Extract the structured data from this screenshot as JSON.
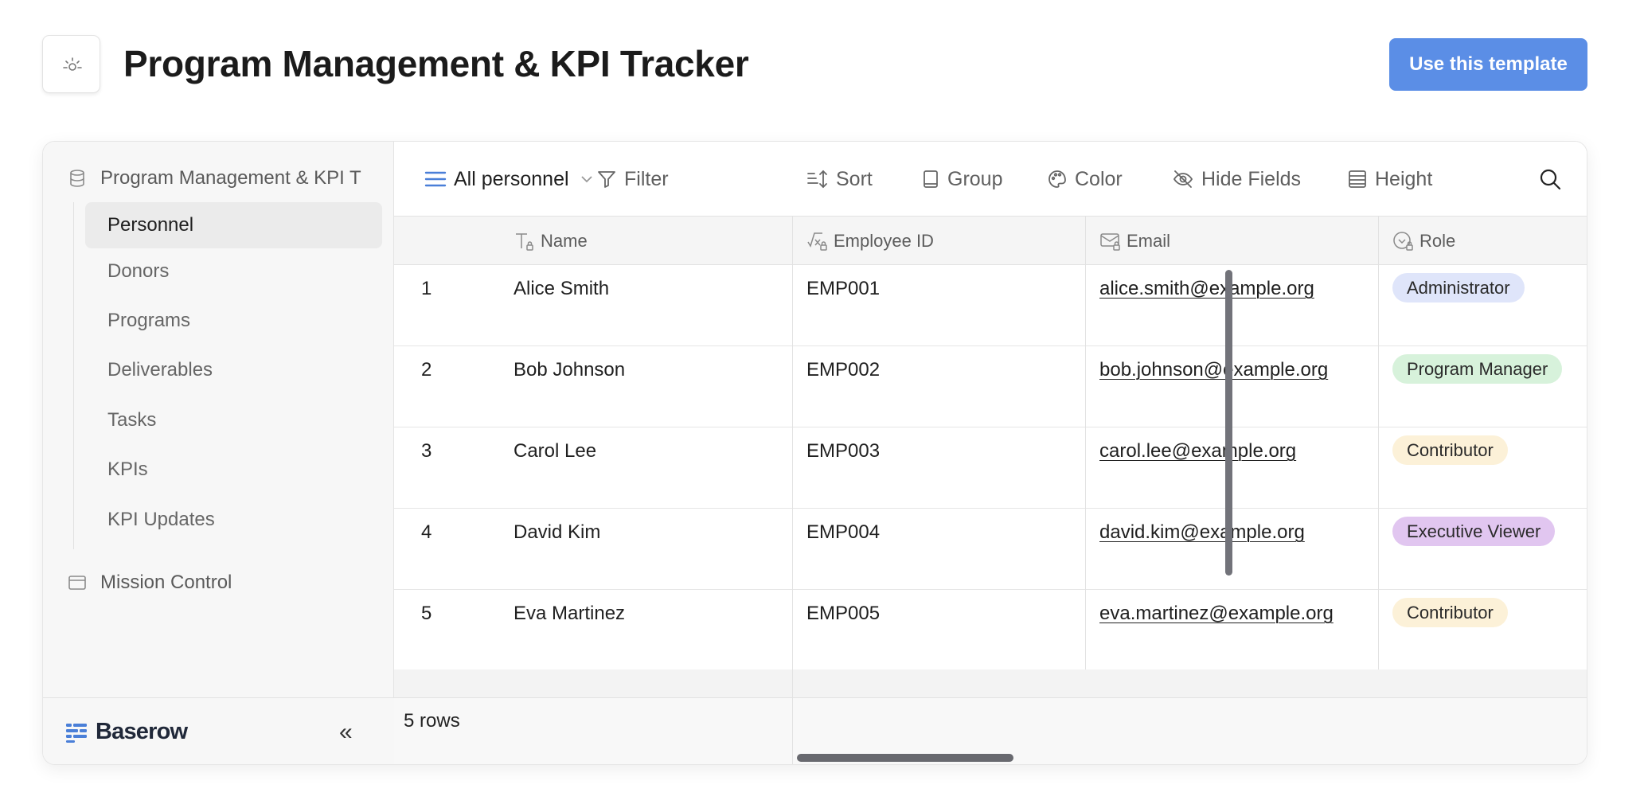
{
  "header": {
    "title": "Program Management & KPI Tracker",
    "cta_label": "Use this template",
    "template_icon": "sparkle-icon"
  },
  "sidebar": {
    "database_label": "Program Management & KPI T",
    "tables": [
      {
        "label": "Personnel",
        "active": true
      },
      {
        "label": "Donors",
        "active": false
      },
      {
        "label": "Programs",
        "active": false
      },
      {
        "label": "Deliverables",
        "active": false
      },
      {
        "label": "Tasks",
        "active": false
      },
      {
        "label": "KPIs",
        "active": false
      },
      {
        "label": "KPI Updates",
        "active": false
      }
    ],
    "application_label": "Mission Control",
    "brand": "Baserow",
    "collapse_label": "«"
  },
  "toolbar": {
    "view_name": "All personnel",
    "filter": "Filter",
    "sort": "Sort",
    "group": "Group",
    "color": "Color",
    "hide_fields": "Hide Fields",
    "height": "Height"
  },
  "grid": {
    "columns": [
      "Name",
      "Employee ID",
      "Email",
      "Role"
    ],
    "rows": [
      {
        "n": "1",
        "name": "Alice Smith",
        "id": "EMP001",
        "email": "alice.smith@example.org",
        "role": "Administrator",
        "role_color": "#dfe5fa"
      },
      {
        "n": "2",
        "name": "Bob Johnson",
        "id": "EMP002",
        "email": "bob.johnson@example.org",
        "role": "Program Manager",
        "role_color": "#d7f2db"
      },
      {
        "n": "3",
        "name": "Carol Lee",
        "id": "EMP003",
        "email": "carol.lee@example.org",
        "role": "Contributor",
        "role_color": "#fcf1d8"
      },
      {
        "n": "4",
        "name": "David Kim",
        "id": "EMP004",
        "email": "david.kim@example.org",
        "role": "Executive Viewer",
        "role_color": "#e1c6f0"
      },
      {
        "n": "5",
        "name": "Eva Martinez",
        "id": "EMP005",
        "email": "eva.martinez@example.org",
        "role": "Contributor",
        "role_color": "#fcf1d8"
      }
    ],
    "row_count": "5 rows"
  },
  "colors": {
    "accent": "#5b8ee6",
    "view_icon": "#4a7fd8"
  }
}
